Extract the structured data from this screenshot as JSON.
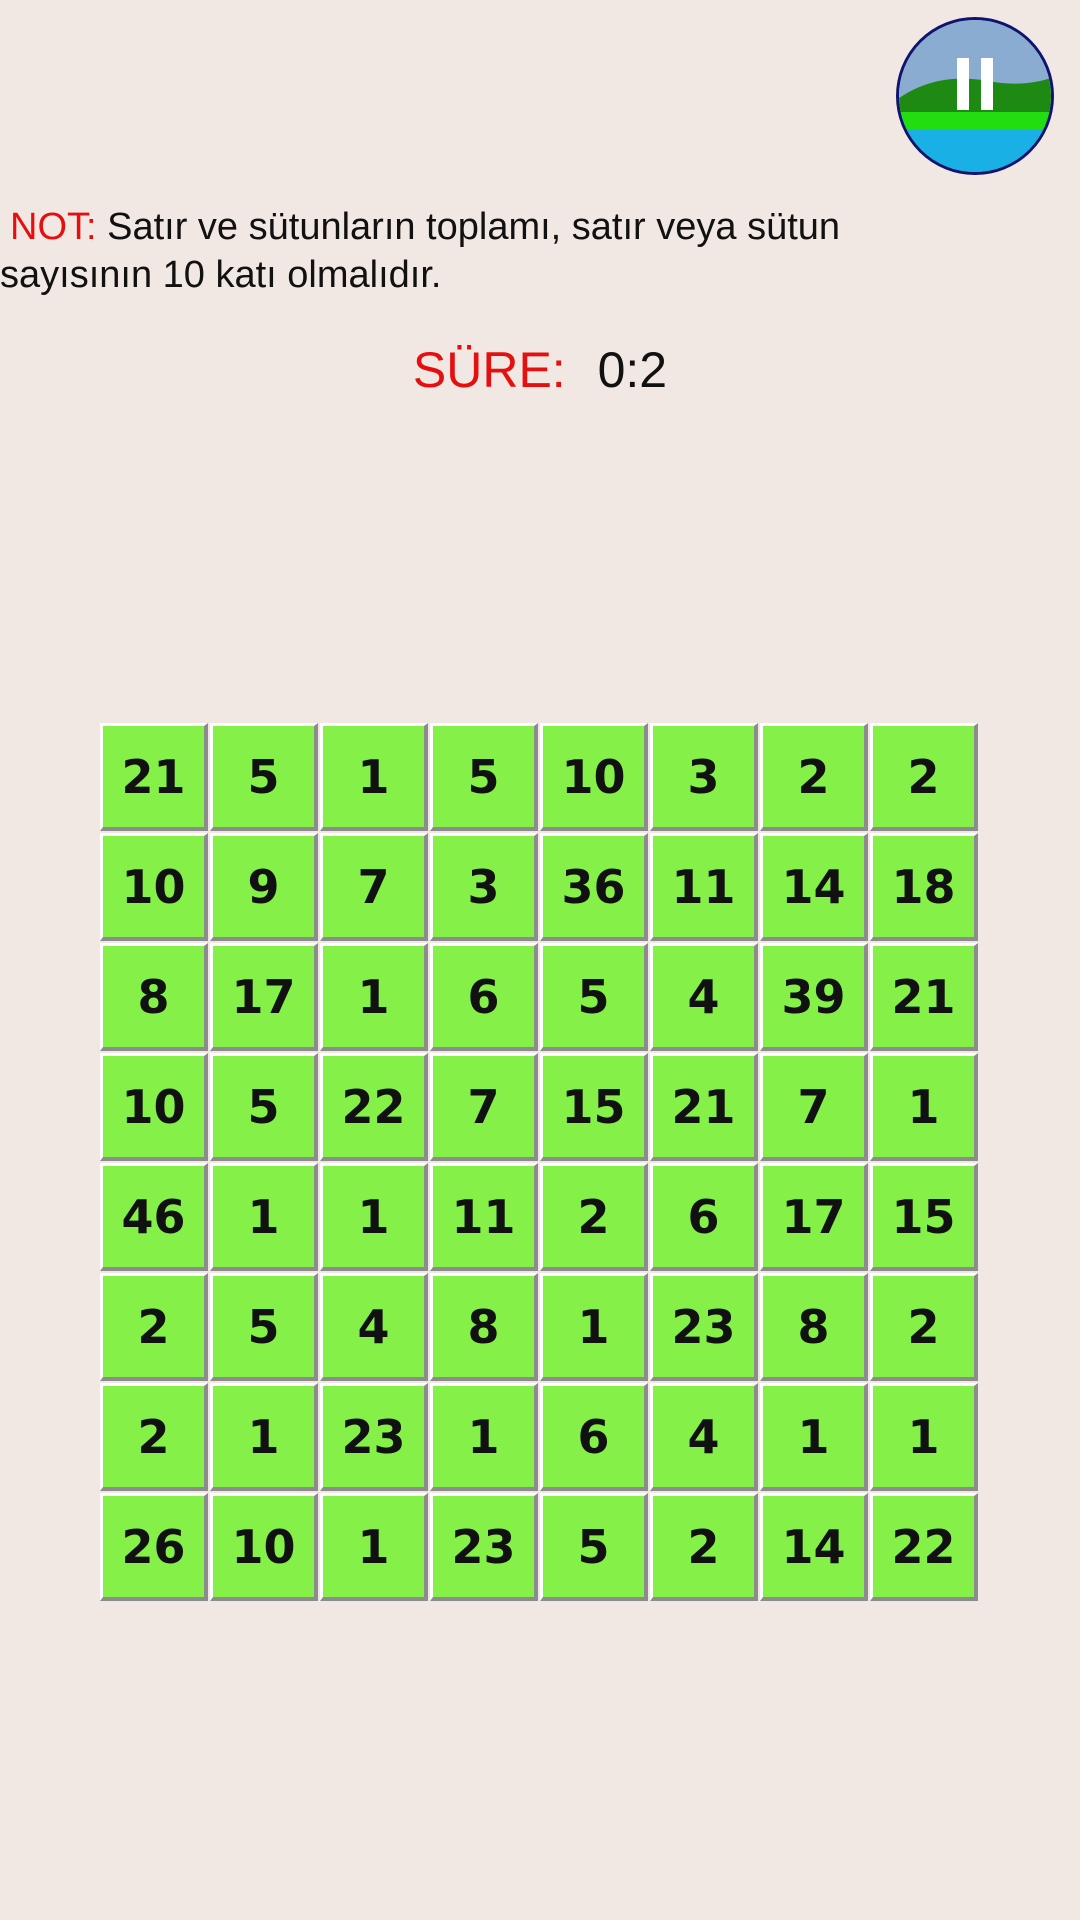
{
  "header": {
    "pause_button": {
      "icon": "pause-icon"
    }
  },
  "instruction": {
    "label": "NOT:",
    "text": "Satır ve sütunların toplamı, satır veya sütun sayısının 10 katı olmalıdır."
  },
  "timer": {
    "label": "SÜRE:",
    "value": "0:2"
  },
  "colors": {
    "background": "#f2e8e3",
    "cell": "#85f048",
    "accent_red": "#e60f0f"
  },
  "grid": {
    "rows": [
      [
        "21",
        "5",
        "1",
        "5",
        "10",
        "3",
        "2",
        "2"
      ],
      [
        "10",
        "9",
        "7",
        "3",
        "36",
        "11",
        "14",
        "18"
      ],
      [
        "8",
        "17",
        "1",
        "6",
        "5",
        "4",
        "39",
        "21"
      ],
      [
        "10",
        "5",
        "22",
        "7",
        "15",
        "21",
        "7",
        "1"
      ],
      [
        "46",
        "1",
        "1",
        "11",
        "2",
        "6",
        "17",
        "15"
      ],
      [
        "2",
        "5",
        "4",
        "8",
        "1",
        "23",
        "8",
        "2"
      ],
      [
        "2",
        "1",
        "23",
        "1",
        "6",
        "4",
        "1",
        "1"
      ],
      [
        "26",
        "10",
        "1",
        "23",
        "5",
        "2",
        "14",
        "22"
      ]
    ]
  }
}
